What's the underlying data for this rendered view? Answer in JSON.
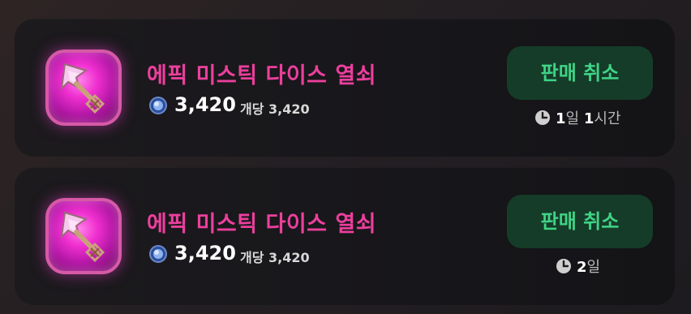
{
  "colors": {
    "item_name": "#ec3f9d",
    "button_bg": "#153c28",
    "button_text": "#3fd386",
    "card_bg": "#1a181b"
  },
  "listings": [
    {
      "item_name": "에픽 미스틱 다이스 열쇠",
      "icon": "mystic-dice-key-icon",
      "currency_icon": "blue-coin-icon",
      "price": "3,420",
      "unit_price_label": "개당 3,420",
      "cancel_label": "판매 취소",
      "time_icon": "clock-icon",
      "time_left": [
        {
          "num": "1",
          "unit": "일"
        },
        {
          "num": "1",
          "unit": "시간"
        }
      ]
    },
    {
      "item_name": "에픽 미스틱 다이스 열쇠",
      "icon": "mystic-dice-key-icon",
      "currency_icon": "blue-coin-icon",
      "price": "3,420",
      "unit_price_label": "개당 3,420",
      "cancel_label": "판매 취소",
      "time_icon": "clock-icon",
      "time_left": [
        {
          "num": "2",
          "unit": "일"
        }
      ]
    }
  ]
}
